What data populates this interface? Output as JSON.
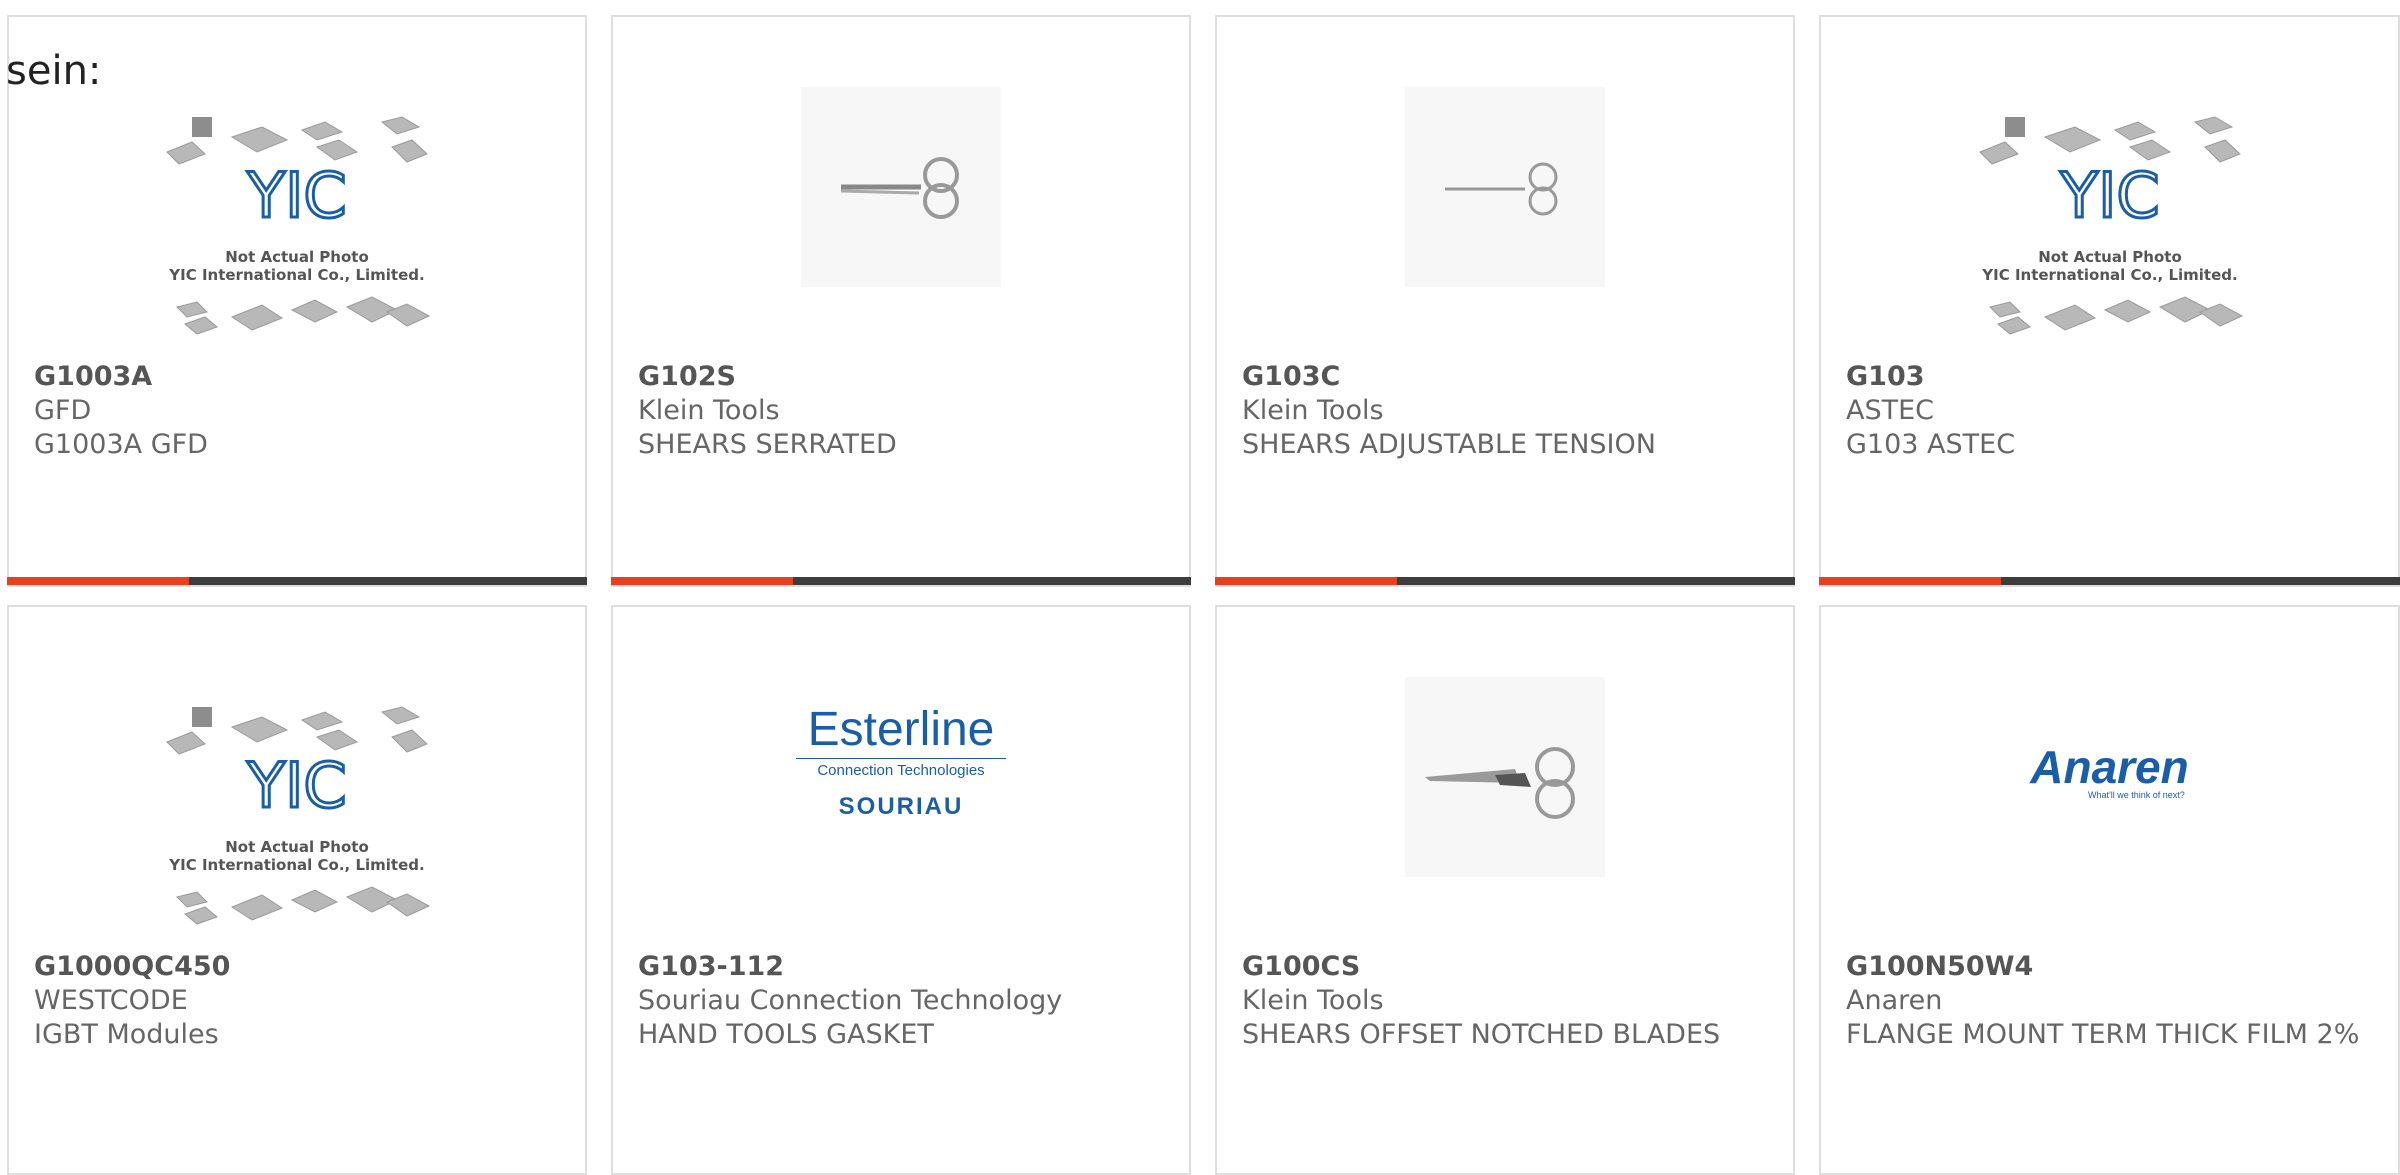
{
  "heading": "sein:",
  "placeholder": {
    "line1": "Not Actual Photo",
    "line2": "YIC International Co., Limited.",
    "logo": "YIC"
  },
  "cards": [
    {
      "part": "G1003A",
      "manufacturer": "GFD",
      "description": "G1003A GFD",
      "image": "yic-placeholder"
    },
    {
      "part": "G102S",
      "manufacturer": "Klein Tools",
      "description": "SHEARS SERRATED",
      "image": "scissors-thin"
    },
    {
      "part": "G103C",
      "manufacturer": "Klein Tools",
      "description": "SHEARS ADJUSTABLE TENSION",
      "image": "scissors-small"
    },
    {
      "part": "G103",
      "manufacturer": "ASTEC",
      "description": "G103 ASTEC",
      "image": "yic-placeholder"
    },
    {
      "part": "G1000QC450",
      "manufacturer": "WESTCODE",
      "description": "IGBT Modules",
      "image": "yic-placeholder"
    },
    {
      "part": "G103-112",
      "manufacturer": "Souriau Connection Technology",
      "description": "HAND TOOLS GASKET",
      "image": "esterline-logo"
    },
    {
      "part": "G100CS",
      "manufacturer": "Klein Tools",
      "description": "SHEARS OFFSET NOTCHED BLADES",
      "image": "scissors-large"
    },
    {
      "part": "G100N50W4",
      "manufacturer": "Anaren",
      "description": "FLANGE MOUNT TERM THICK FILM 2%",
      "image": "anaren-logo"
    }
  ],
  "logos": {
    "esterline": {
      "name": "Esterline",
      "sub": "Connection Technologies",
      "brand": "SOURIAU"
    },
    "anaren": {
      "name": "Anaren",
      "tagline": "What'll we think of next?"
    }
  },
  "colors": {
    "accent": "#e8401c",
    "bar": "#3d3d3d",
    "logo_blue": "#1b5ea8"
  }
}
